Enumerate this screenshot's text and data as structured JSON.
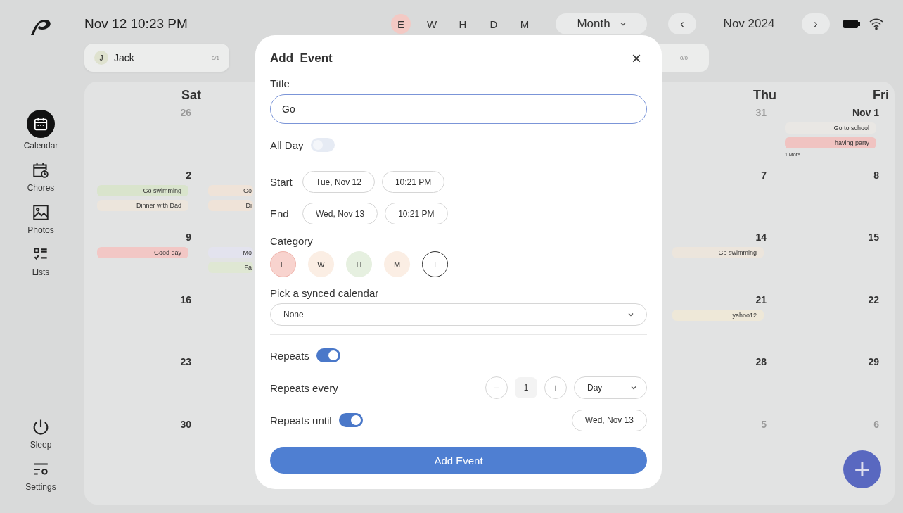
{
  "clock": "Nov 12 10:23 PM",
  "filters": [
    {
      "label": "E",
      "selected": true
    },
    {
      "label": "W",
      "selected": false
    },
    {
      "label": "H",
      "selected": false
    },
    {
      "label": "D",
      "selected": false
    },
    {
      "label": "M",
      "selected": false
    }
  ],
  "view_select": {
    "value": "Month"
  },
  "month_nav": {
    "prev": "‹",
    "label": "Nov 2024",
    "next": "›"
  },
  "sidebar": {
    "items": [
      {
        "label": "Calendar",
        "selected": true
      },
      {
        "label": "Chores",
        "selected": false
      },
      {
        "label": "Photos",
        "selected": false
      },
      {
        "label": "Lists",
        "selected": false
      }
    ],
    "bottom_items": [
      {
        "label": "Sleep",
        "selected": false
      },
      {
        "label": "Settings",
        "selected": false
      }
    ]
  },
  "members": [
    {
      "initial": "J",
      "name": "Jack",
      "count": "0/1"
    },
    {
      "count": "0/0"
    }
  ],
  "calendar": {
    "left_columns": [
      {
        "day": "Sat",
        "cells": [
          {
            "date": "26",
            "muted": true
          },
          {
            "date": "2",
            "muted": false,
            "events": [
              {
                "title": "Go swimming",
                "color": "#d9e4cc"
              },
              {
                "title": "Dinner with Dad",
                "color": "#ece5dc"
              }
            ]
          },
          {
            "date": "9",
            "muted": false,
            "events": [
              {
                "title": "Good day",
                "color": "#f2c7c5"
              }
            ]
          },
          {
            "date": "16",
            "muted": false
          },
          {
            "date": "23",
            "muted": false
          },
          {
            "date": "30",
            "muted": false
          }
        ]
      },
      {
        "cells": [
          {},
          {
            "events": [
              {
                "title": "Go",
                "color": "#efe3d8"
              },
              {
                "title": "Di",
                "color": "#efe3d8"
              }
            ]
          },
          {
            "events": [
              {
                "title": "Mo",
                "color": "#e3e3ee"
              },
              {
                "title": "Fa",
                "color": "#dfe7d3"
              }
            ]
          }
        ]
      }
    ],
    "right_columns": [
      {
        "day": "Thu",
        "cells": [
          {
            "date": "31",
            "muted": true
          },
          {
            "date": "7",
            "muted": false
          },
          {
            "date": "14",
            "muted": false,
            "events": [
              {
                "title": "Go swimming",
                "color": "#ece5dc"
              }
            ]
          },
          {
            "date": "21",
            "muted": false,
            "events": [
              {
                "title": "yahoo12",
                "color": "#eee8d8"
              }
            ]
          },
          {
            "date": "28",
            "muted": false
          },
          {
            "date": "5",
            "muted": true
          }
        ]
      },
      {
        "day": "Fri",
        "cells": [
          {
            "date": "Nov 1",
            "muted": false,
            "events": [
              {
                "title": "Go to school",
                "color": "#e9e7e4"
              },
              {
                "title": "having party",
                "color": "#f0c3c1"
              }
            ],
            "more": "1 More"
          },
          {
            "date": "8",
            "muted": false
          },
          {
            "date": "15",
            "muted": false
          },
          {
            "date": "22",
            "muted": false
          },
          {
            "date": "29",
            "muted": false
          },
          {
            "date": "6",
            "muted": true
          }
        ]
      }
    ]
  },
  "fab": {
    "label": "+"
  },
  "dialog": {
    "title": "Add  Event",
    "close": "×",
    "title_label": "Title",
    "title_value": "Go",
    "all_day": {
      "label": "All Day",
      "on": false
    },
    "start": {
      "label": "Start",
      "date": "Tue, Nov 12",
      "time": "10:21 PM"
    },
    "end": {
      "label": "End",
      "date": "Wed, Nov 13",
      "time": "10:21 PM"
    },
    "category_label": "Category",
    "categories": [
      {
        "kind": "tag",
        "label": "E",
        "selected": true,
        "color": "#f8d3ce"
      },
      {
        "kind": "tag",
        "label": "W",
        "selected": false,
        "color": "#fbeee4"
      },
      {
        "kind": "tag",
        "label": "H",
        "selected": false,
        "color": "#e6f0e0"
      },
      {
        "kind": "tag",
        "label": "M",
        "selected": false,
        "color": "#fbeee4"
      },
      {
        "kind": "add",
        "label": "+",
        "selected": false
      }
    ],
    "calendar_label": "Pick a synced calendar",
    "calendar_value": "None",
    "repeats": {
      "label": "Repeats",
      "on": true
    },
    "repeats_every": {
      "label": "Repeats every",
      "minus": "−",
      "count": "1",
      "plus": "+",
      "unit": "Day"
    },
    "repeats_until": {
      "label": "Repeats until",
      "on": true,
      "date": "Wed, Nov 13"
    },
    "submit": "Add Event"
  }
}
